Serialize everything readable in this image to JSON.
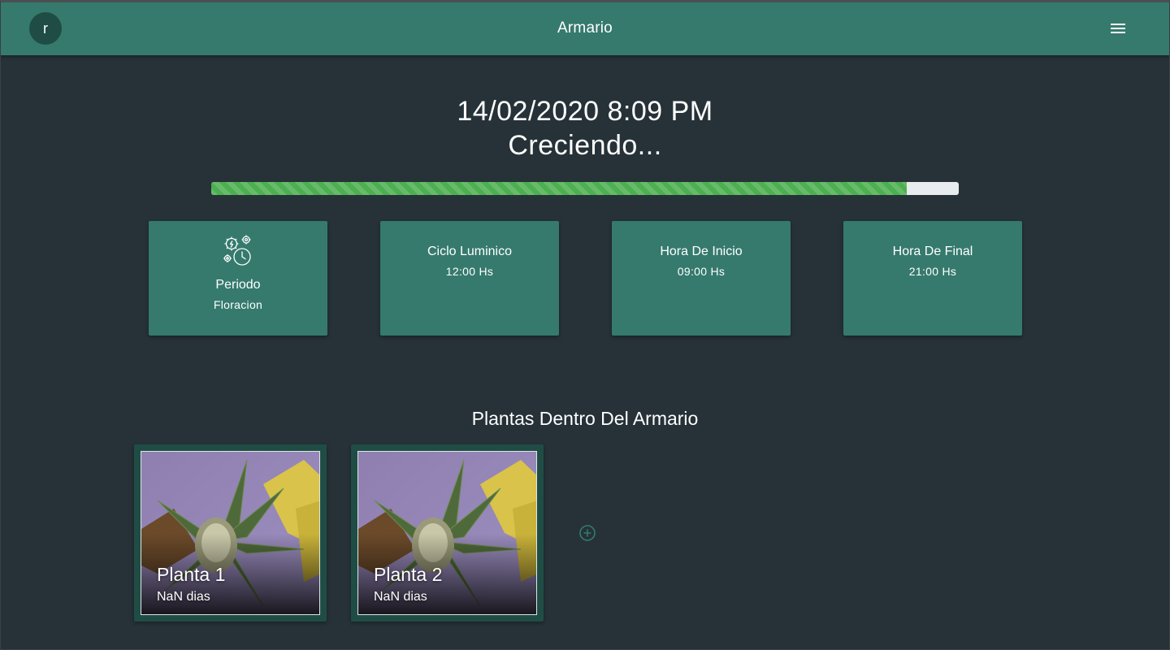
{
  "colors": {
    "background": "#263238",
    "primary": "#357a6d",
    "primary_dark": "#1f4d45",
    "progress": "#4caf50",
    "progress_track": "#e9ecef"
  },
  "header": {
    "avatar_initial": "r",
    "title": "Armario",
    "menu_icon": "hamburger-menu-icon"
  },
  "status_panel": {
    "datetime": "14/02/2020 8:09 PM",
    "status": "Creciendo...",
    "progress_fraction": 0.93
  },
  "info_cards": [
    {
      "icon": "gear-clock-icon",
      "title": "Periodo",
      "value": "Floracion"
    },
    {
      "title": "Ciclo Luminico",
      "value": "12:00 Hs"
    },
    {
      "title": "Hora De Inicio",
      "value": "09:00 Hs"
    },
    {
      "title": "Hora De Final",
      "value": "21:00 Hs"
    }
  ],
  "plants_section": {
    "title": "Plantas Dentro Del Armario",
    "plants": [
      {
        "name": "Planta 1",
        "days": "NaN dias"
      },
      {
        "name": "Planta 2",
        "days": "NaN dias"
      }
    ],
    "add_icon": "add-circle-icon"
  }
}
